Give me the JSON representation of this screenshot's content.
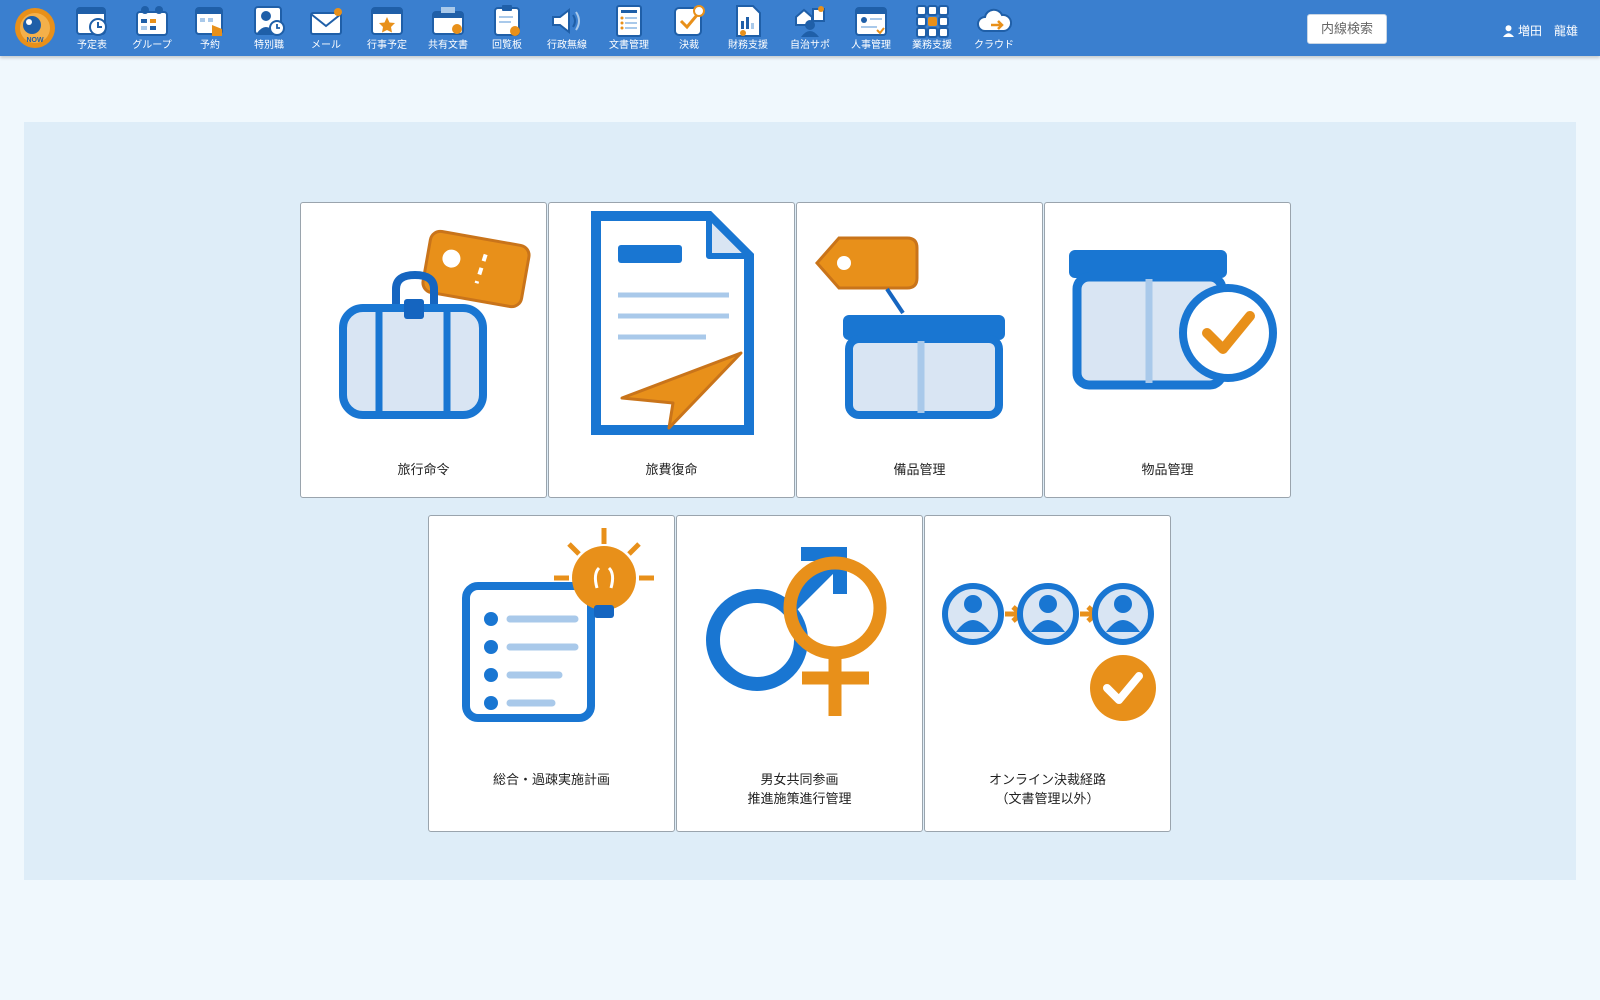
{
  "header": {
    "nav": [
      {
        "label": "予定表",
        "icon": "calendar-clock-icon"
      },
      {
        "label": "グループ",
        "icon": "group-calendar-icon"
      },
      {
        "label": "予約",
        "icon": "reservation-icon"
      },
      {
        "label": "特別職",
        "icon": "special-staff-icon"
      },
      {
        "label": "メール",
        "icon": "mail-icon"
      },
      {
        "label": "行事予定",
        "icon": "event-calendar-icon"
      },
      {
        "label": "共有文書",
        "icon": "shared-document-icon"
      },
      {
        "label": "回覧板",
        "icon": "circular-board-icon"
      },
      {
        "label": "行政無線",
        "icon": "broadcast-speaker-icon"
      },
      {
        "label": "文書管理",
        "icon": "document-management-icon"
      },
      {
        "label": "決裁",
        "icon": "approval-icon"
      },
      {
        "label": "財務支援",
        "icon": "finance-icon"
      },
      {
        "label": "自治サポ",
        "icon": "community-support-icon"
      },
      {
        "label": "人事管理",
        "icon": "personnel-icon"
      },
      {
        "label": "業務支援",
        "icon": "business-grid-icon"
      },
      {
        "label": "クラウド",
        "icon": "cloud-icon"
      }
    ],
    "search_label": "内線検索",
    "user_name": "増田　龍雄"
  },
  "cards": [
    {
      "title": [
        "旅行命令"
      ],
      "icon": "suitcase-tag-icon"
    },
    {
      "title": [
        "旅費復命"
      ],
      "icon": "document-send-icon"
    },
    {
      "title": [
        "備品管理"
      ],
      "icon": "box-tag-icon"
    },
    {
      "title": [
        "物品管理"
      ],
      "icon": "box-check-icon"
    },
    {
      "title": [
        "総合・過疎実施計画"
      ],
      "icon": "plan-idea-icon"
    },
    {
      "title": [
        "男女共同参画",
        "推進施策進行管理"
      ],
      "icon": "gender-equality-icon"
    },
    {
      "title": [
        "オンライン決裁経路",
        "（文書管理以外）"
      ],
      "icon": "approval-route-icon"
    }
  ],
  "colors": {
    "header": "#3a7fcf",
    "primary_blue": "#1976d2",
    "light_blue": "#a9c9ea",
    "fill_blue": "#d9e5f3",
    "orange": "#e8901a",
    "panel": "#deedf8",
    "page": "#f0f8fd"
  }
}
